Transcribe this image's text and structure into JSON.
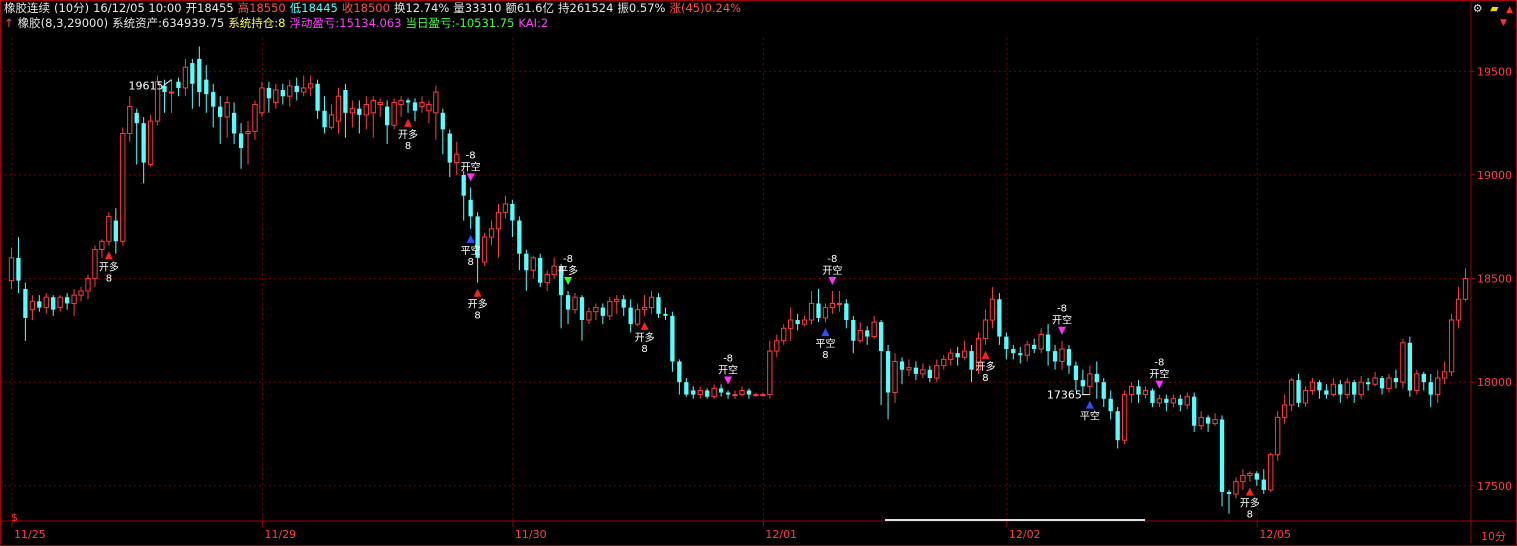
{
  "header": {
    "symbol_title": "橡胶连续",
    "period": "(10分)",
    "datetime": "16/12/05 10:00",
    "open": "开18455",
    "high": "高18550",
    "low": "低18445",
    "close": "收18500",
    "turnover": "换12.74%",
    "volume": "量33310",
    "amount": "额61.6亿",
    "open_interest": "持261524",
    "amplitude": "振0.57%",
    "change_label": "涨(45)",
    "change_pct": "0.24%"
  },
  "indicator": {
    "name": "橡胶(8,3,29000)",
    "assets": "系统资产:634939.75",
    "position": "系统持仓:8",
    "floating_pnl": "浮动盈亏:15134.063",
    "daily_pnl": "当日盈亏:-10531.75",
    "kai": "KAI:2"
  },
  "toolbar": {
    "icons": [
      "settings-icon",
      "ruler-icon",
      "up-icon",
      "down-icon"
    ]
  },
  "bottom_marker": "$",
  "period_corner_label": "10分",
  "colors": {
    "up": "#ff3c3c",
    "down": "#55ffff",
    "grid": "#7a0000",
    "axis": "#a00000",
    "axis_text": "#ff4040",
    "signal_up": "#ff2020",
    "signal_down": "#ff30ff"
  },
  "chart_data": {
    "type": "candlestick",
    "y_axis": {
      "ticks": [
        17500,
        18000,
        18500,
        19000,
        19500
      ],
      "range": [
        17330,
        19690
      ]
    },
    "x_labels": [
      {
        "label": "11/25",
        "index": 0
      },
      {
        "label": "11/29",
        "index": 36
      },
      {
        "label": "11/30",
        "index": 72
      },
      {
        "label": "12/01",
        "index": 108
      },
      {
        "label": "12/02",
        "index": 143
      },
      {
        "label": "12/05",
        "index": 179
      }
    ],
    "annotations": [
      {
        "text": "19615",
        "index": 23
      },
      {
        "text": "17365",
        "index": 155
      }
    ],
    "candles": [
      [
        18490,
        18600,
        18450,
        18650
      ],
      [
        18600,
        18490,
        18430,
        18700
      ],
      [
        18450,
        18310,
        18200,
        18480
      ],
      [
        18350,
        18390,
        18300,
        18420
      ],
      [
        18390,
        18360,
        18340,
        18420
      ],
      [
        18360,
        18410,
        18330,
        18430
      ],
      [
        18410,
        18350,
        18320,
        18420
      ],
      [
        18360,
        18410,
        18340,
        18420
      ],
      [
        18410,
        18380,
        18350,
        18430
      ],
      [
        18380,
        18420,
        18320,
        18450
      ],
      [
        18420,
        18440,
        18390,
        18460
      ],
      [
        18440,
        18500,
        18400,
        18520
      ],
      [
        18500,
        18640,
        18460,
        18660
      ],
      [
        18640,
        18680,
        18600,
        18690
      ],
      [
        18680,
        18800,
        18660,
        18820
      ],
      [
        18780,
        18680,
        18620,
        18840
      ],
      [
        18680,
        19200,
        18660,
        19230
      ],
      [
        19200,
        19330,
        19160,
        19380
      ],
      [
        19300,
        19250,
        19050,
        19320
      ],
      [
        19250,
        19060,
        18960,
        19280
      ],
      [
        19050,
        19260,
        19040,
        19290
      ],
      [
        19260,
        19450,
        19240,
        19480
      ],
      [
        19430,
        19400,
        19300,
        19460
      ],
      [
        19400,
        19400,
        19300,
        19460
      ],
      [
        19450,
        19420,
        19380,
        19470
      ],
      [
        19420,
        19520,
        19380,
        19560
      ],
      [
        19540,
        19440,
        19320,
        19560
      ],
      [
        19560,
        19400,
        19330,
        19620
      ],
      [
        19460,
        19390,
        19300,
        19530
      ],
      [
        19400,
        19330,
        19230,
        19440
      ],
      [
        19330,
        19280,
        19150,
        19380
      ],
      [
        19280,
        19350,
        19180,
        19380
      ],
      [
        19300,
        19200,
        19150,
        19350
      ],
      [
        19200,
        19130,
        19030,
        19250
      ],
      [
        19200,
        19210,
        19050,
        19260
      ],
      [
        19210,
        19340,
        19170,
        19360
      ],
      [
        19300,
        19420,
        19280,
        19450
      ],
      [
        19420,
        19370,
        19300,
        19450
      ],
      [
        19350,
        19410,
        19320,
        19440
      ],
      [
        19410,
        19380,
        19340,
        19440
      ],
      [
        19380,
        19430,
        19330,
        19460
      ],
      [
        19430,
        19400,
        19360,
        19470
      ],
      [
        19400,
        19420,
        19380,
        19480
      ],
      [
        19420,
        19440,
        19380,
        19480
      ],
      [
        19440,
        19310,
        19270,
        19460
      ],
      [
        19310,
        19230,
        19200,
        19380
      ],
      [
        19230,
        19290,
        19220,
        19340
      ],
      [
        19260,
        19380,
        19200,
        19420
      ],
      [
        19410,
        19300,
        19180,
        19440
      ],
      [
        19300,
        19320,
        19230,
        19360
      ],
      [
        19320,
        19290,
        19200,
        19360
      ],
      [
        19290,
        19340,
        19220,
        19380
      ],
      [
        19300,
        19360,
        19180,
        19380
      ],
      [
        19340,
        19350,
        19280,
        19370
      ],
      [
        19330,
        19240,
        19150,
        19360
      ],
      [
        19240,
        19350,
        19220,
        19370
      ],
      [
        19340,
        19360,
        19280,
        19380
      ],
      [
        19360,
        19350,
        19300,
        19370
      ],
      [
        19350,
        19310,
        19260,
        19370
      ],
      [
        19330,
        19350,
        19300,
        19380
      ],
      [
        19310,
        19340,
        19250,
        19360
      ],
      [
        19300,
        19400,
        19170,
        19430
      ],
      [
        19300,
        19220,
        19100,
        19320
      ],
      [
        19200,
        19060,
        18990,
        19220
      ],
      [
        19060,
        19100,
        19000,
        19160
      ],
      [
        19000,
        18900,
        18780,
        19020
      ],
      [
        18880,
        18800,
        18740,
        18940
      ],
      [
        18800,
        18600,
        18480,
        18820
      ],
      [
        18580,
        18700,
        18560,
        18720
      ],
      [
        18700,
        18740,
        18660,
        18780
      ],
      [
        18740,
        18820,
        18600,
        18860
      ],
      [
        18820,
        18860,
        18790,
        18900
      ]
    ],
    "candles_2": [
      [
        18860,
        18780,
        18700,
        18880
      ],
      [
        18780,
        18620,
        18540,
        18800
      ],
      [
        18620,
        18540,
        18440,
        18640
      ],
      [
        18540,
        18600,
        18500,
        18610
      ],
      [
        18600,
        18480,
        18460,
        18620
      ],
      [
        18480,
        18520,
        18440,
        18540
      ],
      [
        18520,
        18560,
        18500,
        18600
      ],
      [
        18560,
        18420,
        18260,
        18570
      ],
      [
        18420,
        18350,
        18280,
        18440
      ],
      [
        18350,
        18410,
        18330,
        18430
      ],
      [
        18410,
        18300,
        18200,
        18420
      ],
      [
        18300,
        18340,
        18280,
        18360
      ],
      [
        18340,
        18360,
        18300,
        18380
      ],
      [
        18360,
        18320,
        18280,
        18380
      ],
      [
        18320,
        18390,
        18300,
        18410
      ],
      [
        18390,
        18400,
        18330,
        18420
      ],
      [
        18400,
        18360,
        18320,
        18420
      ],
      [
        18360,
        18280,
        18240,
        18400
      ],
      [
        18280,
        18350,
        18270,
        18380
      ],
      [
        18350,
        18360,
        18320,
        18420
      ],
      [
        18360,
        18410,
        18330,
        18440
      ],
      [
        18410,
        18330,
        18310,
        18430
      ],
      [
        18330,
        18320,
        18300,
        18360
      ],
      [
        18320,
        18100,
        18050,
        18340
      ],
      [
        18100,
        18000,
        17940,
        18110
      ],
      [
        18000,
        17940,
        17930,
        18020
      ],
      [
        17960,
        17940,
        17920,
        17980
      ],
      [
        17940,
        17960,
        17920,
        17980
      ],
      [
        17960,
        17930,
        17920,
        17970
      ],
      [
        17930,
        17970,
        17920,
        17990
      ],
      [
        17970,
        17950,
        17930,
        17990
      ],
      [
        17950,
        17940,
        17920,
        17960
      ],
      [
        17940,
        17940,
        17920,
        17960
      ],
      [
        17940,
        17960,
        17930,
        17980
      ],
      [
        17960,
        17940,
        17920,
        17970
      ],
      [
        17940,
        17940,
        17930,
        17950
      ],
      [
        17940,
        17940,
        17930,
        17950
      ],
      [
        17940,
        18150,
        17920,
        18200
      ],
      [
        18150,
        18200,
        18120,
        18230
      ],
      [
        18200,
        18260,
        18180,
        18280
      ],
      [
        18260,
        18300,
        18200,
        18360
      ],
      [
        18300,
        18280,
        18250,
        18330
      ],
      [
        18280,
        18300,
        18270,
        18320
      ],
      [
        18300,
        18380,
        18280,
        18440
      ],
      [
        18380,
        18310,
        18290,
        18450
      ],
      [
        18310,
        18360,
        18290,
        18380
      ],
      [
        18360,
        18380,
        18330,
        18440
      ],
      [
        18380,
        18380,
        18340,
        18440
      ],
      [
        18380,
        18300,
        18260,
        18400
      ],
      [
        18300,
        18200,
        18140,
        18320
      ],
      [
        18200,
        18250,
        18190,
        18290
      ],
      [
        18250,
        18220,
        18180,
        18270
      ],
      [
        18220,
        18290,
        18210,
        18320
      ],
      [
        18290,
        18150,
        17890,
        18300
      ],
      [
        18150,
        17950,
        17820,
        18180
      ],
      [
        17950,
        18100,
        17900,
        18140
      ],
      [
        18100,
        18060,
        17990,
        18120
      ],
      [
        18060,
        18070,
        18030,
        18110
      ],
      [
        18070,
        18040,
        18010,
        18100
      ],
      [
        18040,
        18060,
        18020,
        18090
      ],
      [
        18060,
        18020,
        18000,
        18080
      ],
      [
        18020,
        18080,
        18000,
        18110
      ],
      [
        18080,
        18110,
        18060,
        18130
      ],
      [
        18110,
        18140,
        18080,
        18160
      ],
      [
        18140,
        18120,
        18080,
        18170
      ],
      [
        18120,
        18150,
        18110,
        18200
      ],
      [
        18150,
        18060,
        18000,
        18180
      ],
      [
        18060,
        18210,
        18040,
        18240
      ],
      [
        18210,
        18300,
        18180,
        18350
      ],
      [
        18300,
        18400,
        18260,
        18460
      ],
      [
        18400,
        18220,
        18180,
        18430
      ],
      [
        18220,
        18160,
        18110,
        18240
      ]
    ],
    "candles_3": [
      [
        18160,
        18140,
        18110,
        18180
      ],
      [
        18140,
        18130,
        18090,
        18170
      ],
      [
        18130,
        18180,
        18100,
        18200
      ],
      [
        18180,
        18160,
        18140,
        18210
      ],
      [
        18160,
        18230,
        18140,
        18260
      ],
      [
        18230,
        18150,
        18080,
        18280
      ],
      [
        18150,
        18100,
        18060,
        18180
      ],
      [
        18100,
        18160,
        18060,
        18200
      ],
      [
        18160,
        18080,
        18040,
        18180
      ],
      [
        18080,
        18010,
        17960,
        18100
      ],
      [
        18010,
        17980,
        17940,
        18060
      ],
      [
        17980,
        18040,
        17940,
        18080
      ],
      [
        18040,
        18000,
        17920,
        18100
      ],
      [
        18000,
        17920,
        17880,
        18020
      ],
      [
        17920,
        17860,
        17820,
        17960
      ],
      [
        17860,
        17720,
        17680,
        17880
      ],
      [
        17720,
        17940,
        17700,
        17960
      ],
      [
        17940,
        17980,
        17900,
        18000
      ],
      [
        17980,
        17940,
        17900,
        18010
      ],
      [
        17940,
        17960,
        17920,
        17980
      ],
      [
        17960,
        17900,
        17880,
        17970
      ],
      [
        17900,
        17920,
        17880,
        17940
      ],
      [
        17920,
        17900,
        17860,
        17940
      ],
      [
        17900,
        17920,
        17880,
        17940
      ],
      [
        17920,
        17890,
        17860,
        17940
      ],
      [
        17890,
        17930,
        17870,
        17950
      ],
      [
        17930,
        17790,
        17760,
        17950
      ],
      [
        17790,
        17830,
        17770,
        17860
      ],
      [
        17830,
        17800,
        17760,
        17840
      ],
      [
        17800,
        17820,
        17790,
        17850
      ],
      [
        17820,
        17470,
        17400,
        17840
      ],
      [
        17470,
        17460,
        17365,
        17480
      ],
      [
        17460,
        17520,
        17440,
        17540
      ],
      [
        17520,
        17550,
        17480,
        17580
      ],
      [
        17550,
        17560,
        17520,
        17570
      ],
      [
        17560,
        17530,
        17500,
        17570
      ],
      [
        17530,
        17480,
        17460,
        17580
      ],
      [
        17480,
        17650,
        17470,
        17660
      ],
      [
        17650,
        17830,
        17620,
        17860
      ],
      [
        17830,
        17890,
        17800,
        17940
      ],
      [
        17890,
        18010,
        17860,
        18020
      ],
      [
        18010,
        17900,
        17880,
        18040
      ],
      [
        17900,
        17960,
        17880,
        17980
      ],
      [
        17960,
        18000,
        17940,
        18020
      ],
      [
        18000,
        17960,
        17920,
        18010
      ],
      [
        17960,
        17940,
        17920,
        17990
      ],
      [
        17940,
        17990,
        17930,
        18020
      ],
      [
        17990,
        17940,
        17900,
        18010
      ],
      [
        17940,
        18000,
        17920,
        18020
      ],
      [
        18000,
        17940,
        17900,
        18010
      ],
      [
        17940,
        18000,
        17920,
        18030
      ],
      [
        18000,
        17990,
        17960,
        18020
      ],
      [
        17990,
        18020,
        17980,
        18050
      ],
      [
        18020,
        17970,
        17940,
        18030
      ],
      [
        17970,
        18020,
        17950,
        18040
      ],
      [
        18020,
        18000,
        17970,
        18060
      ],
      [
        18000,
        18190,
        17970,
        18210
      ],
      [
        18190,
        17960,
        17930,
        18220
      ],
      [
        17960,
        18040,
        17940,
        18060
      ],
      [
        18040,
        18000,
        17960,
        18050
      ],
      [
        18000,
        17940,
        17880,
        18040
      ],
      [
        17940,
        18020,
        17900,
        18060
      ],
      [
        18020,
        18050,
        17990,
        18100
      ],
      [
        18050,
        18300,
        18030,
        18330
      ],
      [
        18300,
        18400,
        18260,
        18460
      ],
      [
        18400,
        18500,
        18390,
        18550
      ]
    ],
    "signals": [
      {
        "index": 14,
        "type": "buy",
        "label": "开多",
        "qty": "8"
      },
      {
        "index": 57,
        "type": "buy",
        "label": "开多",
        "qty": "8"
      },
      {
        "index": 66,
        "type": "sell",
        "label": "开空",
        "pre": "-8"
      },
      {
        "index": 66,
        "type": "cover",
        "label": "平空",
        "qty": "8"
      },
      {
        "index": 67,
        "type": "buy",
        "label": "开多",
        "qty": "8"
      },
      {
        "index": 80,
        "type": "sellg",
        "label": "平多",
        "pre": "-8"
      },
      {
        "index": 91,
        "type": "buy",
        "label": "开多",
        "qty": "8"
      },
      {
        "index": 103,
        "type": "sell",
        "label": "开空",
        "pre": "-8"
      },
      {
        "index": 117,
        "type": "cover",
        "label": "平空",
        "qty": "8"
      },
      {
        "index": 118,
        "type": "sell",
        "label": "开空",
        "pre": "-8"
      },
      {
        "index": 140,
        "type": "buy",
        "label": "开多",
        "qty": "8"
      },
      {
        "index": 151,
        "type": "sell",
        "label": "开空",
        "pre": "-8"
      },
      {
        "index": 155,
        "type": "cover",
        "label": "平空",
        "qty": ""
      },
      {
        "index": 165,
        "type": "sell",
        "label": "开空",
        "pre": "-8"
      },
      {
        "index": 178,
        "type": "buy",
        "label": "开多",
        "qty": "8"
      }
    ]
  }
}
